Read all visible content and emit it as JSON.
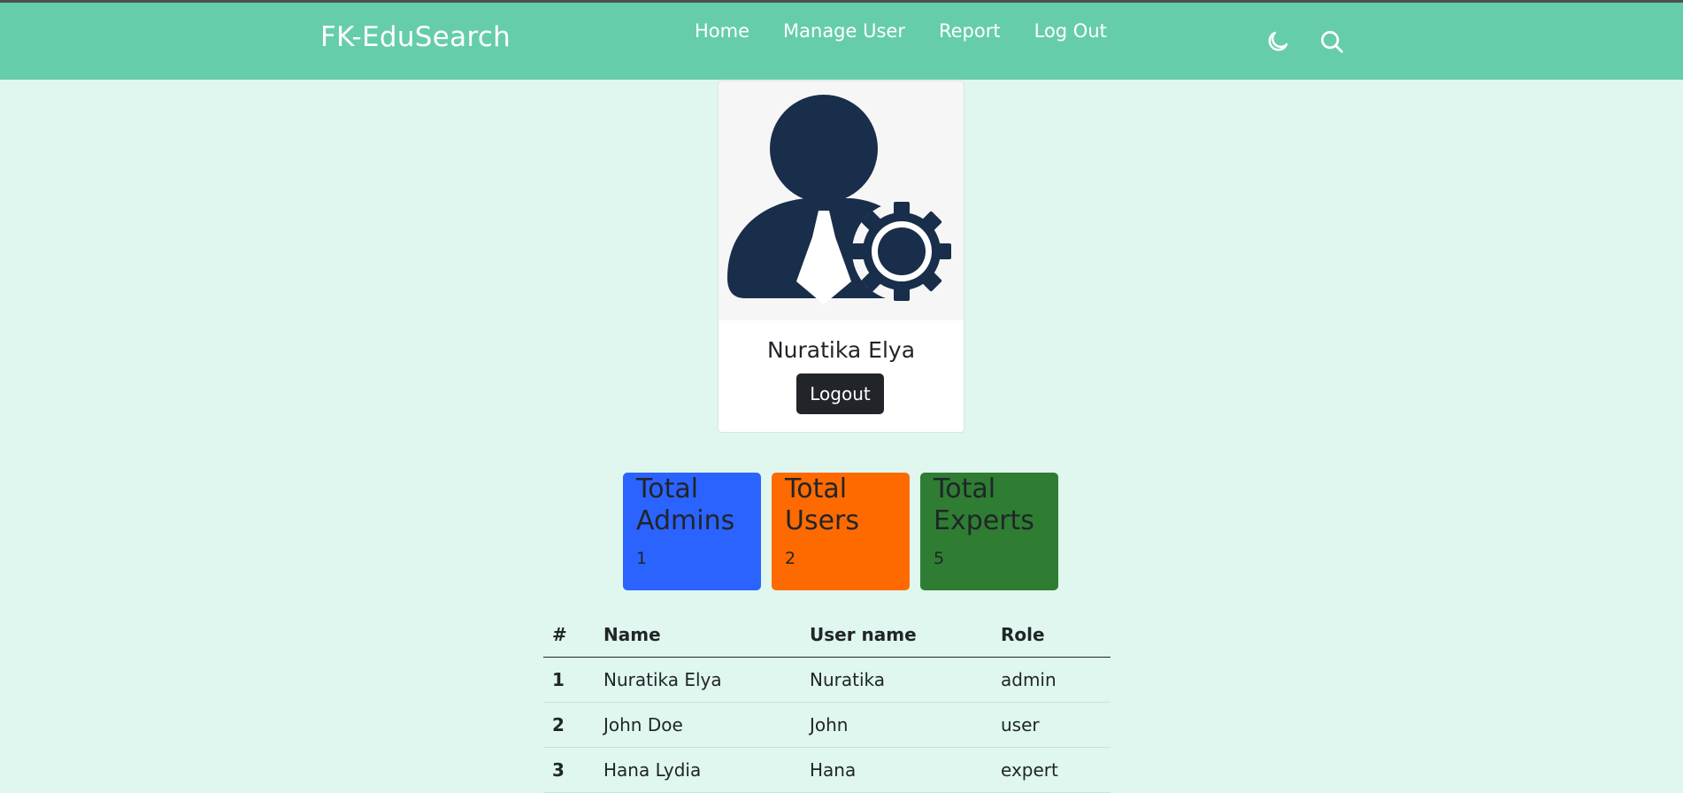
{
  "navbar": {
    "brand": "FK-EduSearch",
    "links": [
      "Home",
      "Manage User",
      "Report",
      "Log Out"
    ],
    "icons": [
      "moon-icon",
      "search-icon"
    ]
  },
  "profile": {
    "name": "Nuratika Elya",
    "logout_label": "Logout",
    "avatar_icon": "admin-user-gear-icon"
  },
  "stats": [
    {
      "title_line1": "Total",
      "title_line2": "Admins",
      "value": "1",
      "color": "#2b63ff"
    },
    {
      "title_line1": "Total",
      "title_line2": "Users",
      "value": "2",
      "color": "#ff6a00"
    },
    {
      "title_line1": "Total",
      "title_line2": "Experts",
      "value": "5",
      "color": "#2e7d32"
    }
  ],
  "table": {
    "headers": [
      "#",
      "Name",
      "User name",
      "Role"
    ],
    "rows": [
      [
        "1",
        "Nuratika Elya",
        "Nuratika",
        "admin"
      ],
      [
        "2",
        "John Doe",
        "John",
        "user"
      ],
      [
        "3",
        "Hana Lydia",
        "Hana",
        "expert"
      ]
    ]
  },
  "colors": {
    "navbar": "#66cdaa",
    "page_background": "#dff7ee",
    "avatar": "#182e4a"
  }
}
